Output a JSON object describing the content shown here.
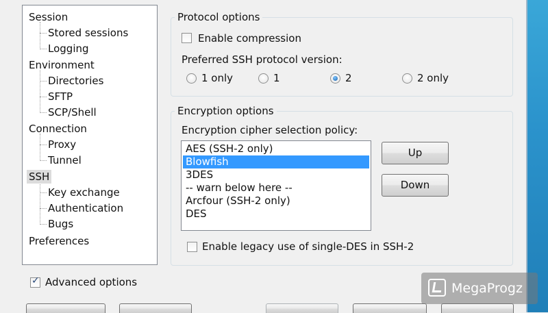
{
  "tree": {
    "items": [
      {
        "label": "Session"
      },
      {
        "label": "Stored sessions"
      },
      {
        "label": "Logging"
      },
      {
        "label": "Environment"
      },
      {
        "label": "Directories"
      },
      {
        "label": "SFTP"
      },
      {
        "label": "SCP/Shell"
      },
      {
        "label": "Connection"
      },
      {
        "label": "Proxy"
      },
      {
        "label": "Tunnel"
      },
      {
        "label": "SSH"
      },
      {
        "label": "Key exchange"
      },
      {
        "label": "Authentication"
      },
      {
        "label": "Bugs"
      },
      {
        "label": "Preferences"
      }
    ],
    "selected": "SSH"
  },
  "protocol": {
    "title": "Protocol options",
    "compression_label": "Enable compression",
    "compression_checked": false,
    "version_label": "Preferred SSH protocol version:",
    "versions": [
      {
        "label": "1 only",
        "checked": false
      },
      {
        "label": "1",
        "checked": false
      },
      {
        "label": "2",
        "checked": true
      },
      {
        "label": "2 only",
        "checked": false
      }
    ]
  },
  "encryption": {
    "title": "Encryption options",
    "policy_label": "Encryption cipher selection policy:",
    "ciphers": [
      "AES (SSH-2 only)",
      "Blowfish",
      "3DES",
      "-- warn below here --",
      "Arcfour (SSH-2 only)",
      "DES"
    ],
    "selected_cipher": "Blowfish",
    "up_label": "Up",
    "down_label": "Down",
    "legacy_label": "Enable legacy use of single-DES in SSH-2",
    "legacy_checked": false
  },
  "advanced": {
    "label": "Advanced options",
    "checked": true
  },
  "watermark": {
    "text": "MegaProgz"
  },
  "colors": {
    "selection": "#3399ff",
    "tree_selected": "#dcdcdc"
  }
}
